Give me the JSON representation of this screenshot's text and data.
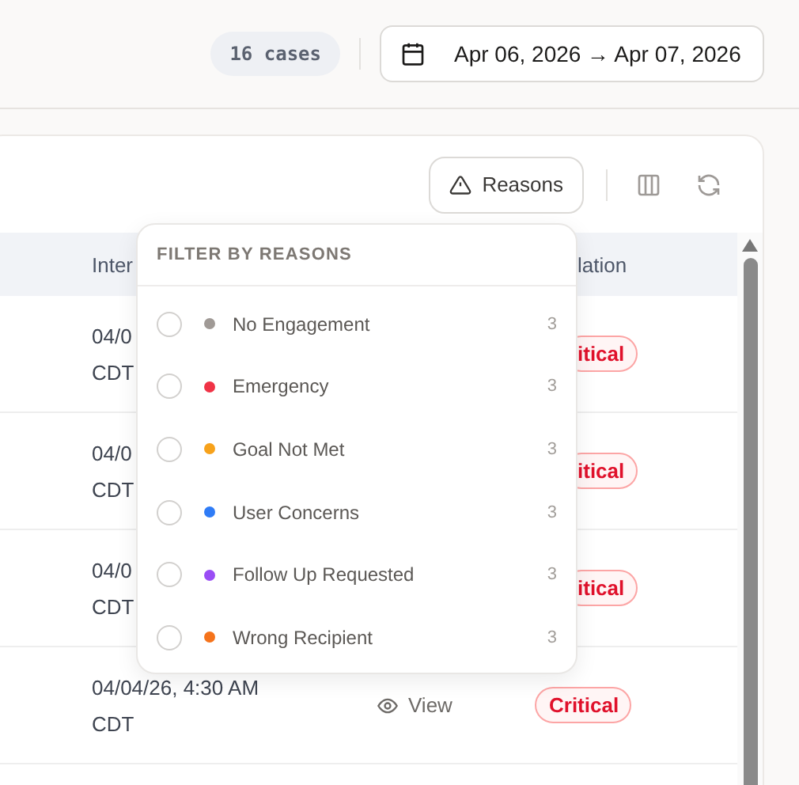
{
  "header": {
    "case_count": "16 cases",
    "date_range": "Apr 06, 2026 → Apr 07, 2026"
  },
  "toolbar": {
    "reasons_button": "Reasons"
  },
  "table": {
    "columns": [
      "Inter",
      "lation"
    ],
    "rows": [
      {
        "time": "04/0",
        "zone": "CDT",
        "severity": "itical"
      },
      {
        "time": "04/0",
        "zone": "CDT",
        "severity": "itical"
      },
      {
        "time": "04/0",
        "zone": "CDT",
        "severity": "itical"
      },
      {
        "time": "04/04/26, 4:30 AM",
        "zone": "CDT",
        "action": "View",
        "severity": "Critical"
      }
    ]
  },
  "filter_menu": {
    "title": "FILTER BY REASONS",
    "items": [
      {
        "label": "No Engagement",
        "count": "3",
        "color": "#a09a96",
        "checked": false
      },
      {
        "label": "Emergency",
        "count": "3",
        "color": "#f03346",
        "checked": false
      },
      {
        "label": "Goal Not Met",
        "count": "3",
        "color": "#f7a21b",
        "checked": false
      },
      {
        "label": "User Concerns",
        "count": "3",
        "color": "#2f7cf6",
        "checked": false
      },
      {
        "label": "Follow Up Requested",
        "count": "3",
        "color": "#9a4df5",
        "checked": false
      },
      {
        "label": "Wrong Recipient",
        "count": "3",
        "color": "#f5731b",
        "checked": false
      }
    ]
  }
}
